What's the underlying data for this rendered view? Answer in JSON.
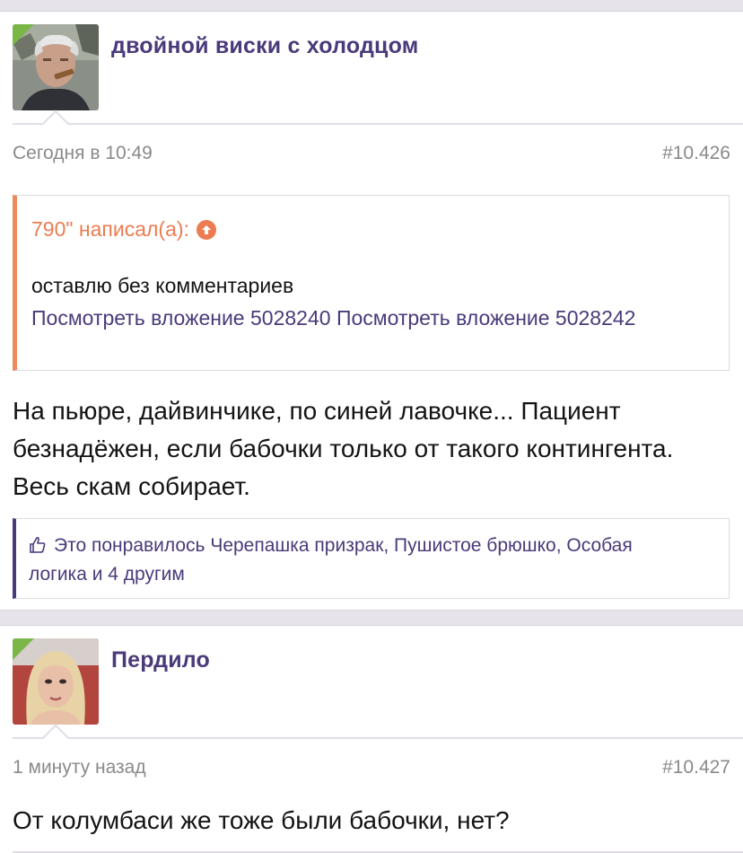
{
  "colors": {
    "username": "#4a3a7a",
    "quote_accent": "#ec8a62",
    "link": "#4a3a7a",
    "online_flag": "#7ab648",
    "meta": "#8a8a8a"
  },
  "posts": [
    {
      "username": "двойной виски с холодцом",
      "avatar_icon": "user-avatar-man-with-cigar",
      "date": "Сегодня в 10:49",
      "post_number": "#10.426",
      "quote": {
        "author": "790\" написал(а):",
        "author_icon": "arrow-up-circle-icon",
        "text": "оставлю без комментариев",
        "attachment_1": "Посмотреть вложение 5028240",
        "attachment_2": "Посмотреть вложение 5028242"
      },
      "message": "На пьюре, дайвинчике, по синей лавочке... Пациент безнадёжен, если бабочки только от такого контингента. Весь скам собирает.",
      "likes": {
        "icon": "thumbs-up-icon",
        "text": "Это понравилось Черепашка призрак, Пушистое брюшко, Особая логика и 4 другим"
      }
    },
    {
      "username": "Пердило",
      "avatar_icon": "user-avatar-blonde-woman",
      "date": "1 минуту назад",
      "post_number": "#10.427",
      "message": "От колумбаси же тоже были бабочки, нет?"
    }
  ]
}
